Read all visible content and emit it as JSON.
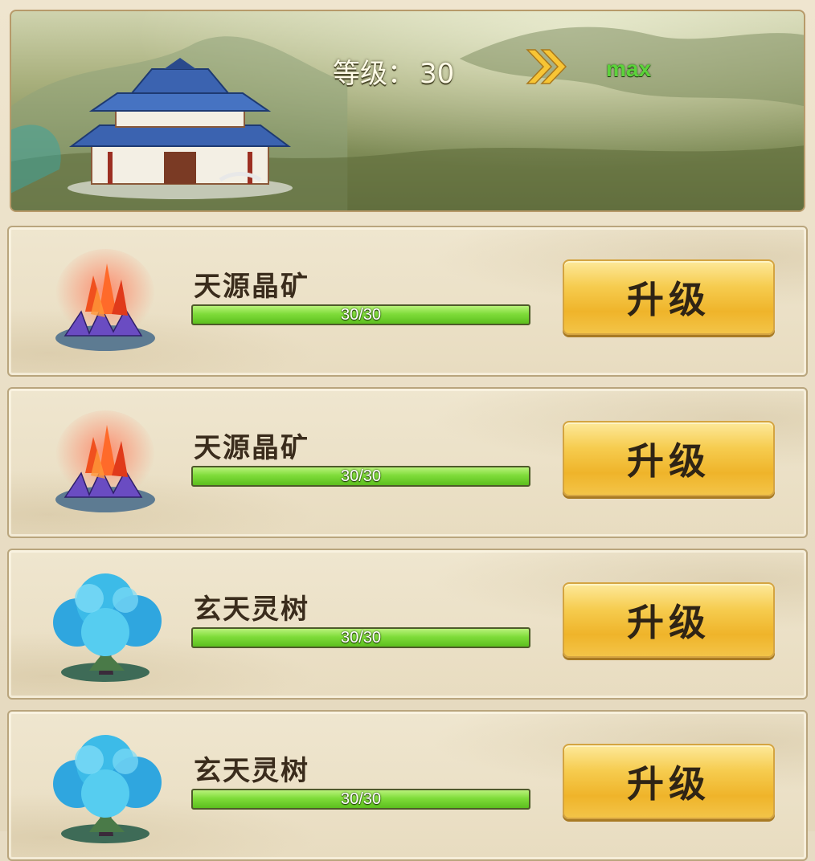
{
  "header": {
    "level_label": "等级：",
    "level_value": "30",
    "max_label": "max"
  },
  "rows": [
    {
      "name": "天源晶矿",
      "progress": "30/30",
      "progress_fraction": 1.0,
      "button": "升级",
      "icon": "crystal-mine-icon"
    },
    {
      "name": "天源晶矿",
      "progress": "30/30",
      "progress_fraction": 1.0,
      "button": "升级",
      "icon": "crystal-mine-icon"
    },
    {
      "name": "玄天灵树",
      "progress": "30/30",
      "progress_fraction": 1.0,
      "button": "升级",
      "icon": "spirit-tree-icon"
    },
    {
      "name": "玄天灵树",
      "progress": "30/30",
      "progress_fraction": 1.0,
      "button": "升级",
      "icon": "spirit-tree-icon"
    }
  ],
  "colors": {
    "max_text": "#5bd33a",
    "progress_fill": "#7fdc3a",
    "button_gold": "#f6cc4f"
  }
}
